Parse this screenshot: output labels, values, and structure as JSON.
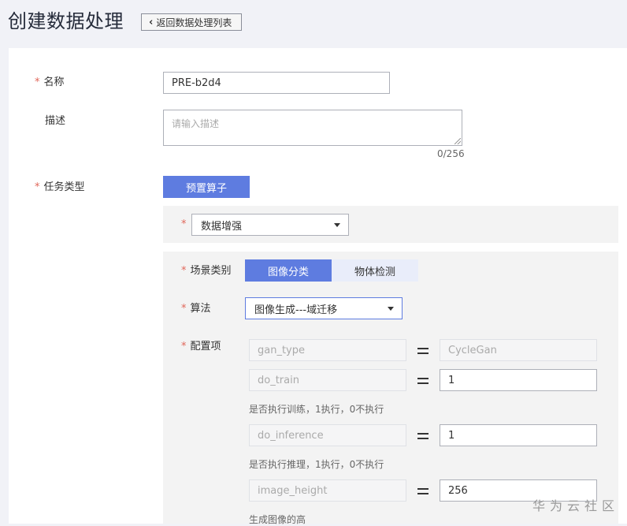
{
  "header": {
    "title": "创建数据处理",
    "back_label": "返回数据处理列表"
  },
  "form": {
    "name": {
      "label": "名称",
      "value": "PRE-b2d4"
    },
    "description": {
      "label": "描述",
      "placeholder": "请输入描述",
      "counter": "0/256"
    },
    "task_type": {
      "label": "任务类型",
      "button_label": "预置算子"
    },
    "operator": {
      "value": "数据增强"
    },
    "scene": {
      "label": "场景类别",
      "options": [
        "图像分类",
        "物体检测"
      ],
      "selected": "图像分类"
    },
    "algorithm": {
      "label": "算法",
      "value": "图像生成---域迁移"
    },
    "config": {
      "label": "配置项",
      "rows": [
        {
          "key": "gan_type",
          "value": "CycleGan",
          "editable": false,
          "hint": ""
        },
        {
          "key": "do_train",
          "value": "1",
          "editable": true,
          "hint": "是否执行训练，1执行，0不执行"
        },
        {
          "key": "do_inference",
          "value": "1",
          "editable": true,
          "hint": "是否执行推理，1执行，0不执行"
        },
        {
          "key": "image_height",
          "value": "256",
          "editable": true,
          "hint": "生成图像的高"
        }
      ]
    }
  },
  "watermark": "华为云社区",
  "colors": {
    "primary": "#5e7ce0",
    "required_star": "#e0675a",
    "background": "#f1f2f7"
  }
}
